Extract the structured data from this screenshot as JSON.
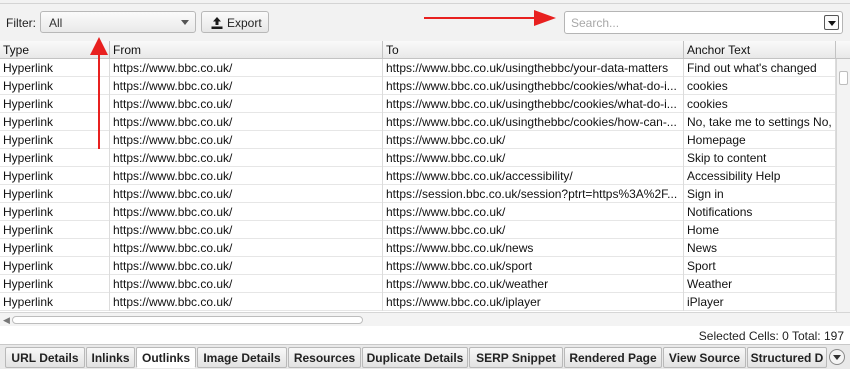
{
  "toolbar": {
    "filter_label": "Filter:",
    "filter_value": "All",
    "export_label": "Export",
    "search_placeholder": "Search..."
  },
  "annotation": {
    "color": "#e8201f"
  },
  "table": {
    "columns": [
      "Type",
      "From",
      "To",
      "Anchor Text"
    ],
    "rows": [
      [
        "Hyperlink",
        "https://www.bbc.co.uk/",
        "https://www.bbc.co.uk/usingthebbc/your-data-matters",
        "Find out what's changed"
      ],
      [
        "Hyperlink",
        "https://www.bbc.co.uk/",
        "https://www.bbc.co.uk/usingthebbc/cookies/what-do-i...",
        "cookies"
      ],
      [
        "Hyperlink",
        "https://www.bbc.co.uk/",
        "https://www.bbc.co.uk/usingthebbc/cookies/what-do-i...",
        "cookies"
      ],
      [
        "Hyperlink",
        "https://www.bbc.co.uk/",
        "https://www.bbc.co.uk/usingthebbc/cookies/how-can-...",
        "No, take me to settings No, t"
      ],
      [
        "Hyperlink",
        "https://www.bbc.co.uk/",
        "https://www.bbc.co.uk/",
        "Homepage"
      ],
      [
        "Hyperlink",
        "https://www.bbc.co.uk/",
        "https://www.bbc.co.uk/",
        "Skip to content"
      ],
      [
        "Hyperlink",
        "https://www.bbc.co.uk/",
        "https://www.bbc.co.uk/accessibility/",
        "Accessibility Help"
      ],
      [
        "Hyperlink",
        "https://www.bbc.co.uk/",
        "https://session.bbc.co.uk/session?ptrt=https%3A%2F...",
        "Sign in"
      ],
      [
        "Hyperlink",
        "https://www.bbc.co.uk/",
        "https://www.bbc.co.uk/",
        "Notifications"
      ],
      [
        "Hyperlink",
        "https://www.bbc.co.uk/",
        "https://www.bbc.co.uk/",
        "Home"
      ],
      [
        "Hyperlink",
        "https://www.bbc.co.uk/",
        "https://www.bbc.co.uk/news",
        "News"
      ],
      [
        "Hyperlink",
        "https://www.bbc.co.uk/",
        "https://www.bbc.co.uk/sport",
        "Sport"
      ],
      [
        "Hyperlink",
        "https://www.bbc.co.uk/",
        "https://www.bbc.co.uk/weather",
        "Weather"
      ],
      [
        "Hyperlink",
        "https://www.bbc.co.uk/",
        "https://www.bbc.co.uk/iplayer",
        "iPlayer"
      ]
    ]
  },
  "status": {
    "text": "Selected Cells:  0  Total:  197"
  },
  "tabs": [
    "URL Details",
    "Inlinks",
    "Outlinks",
    "Image Details",
    "Resources",
    "Duplicate Details",
    "SERP Snippet",
    "Rendered Page",
    "View Source",
    "Structured D"
  ],
  "active_tab_index": 2
}
